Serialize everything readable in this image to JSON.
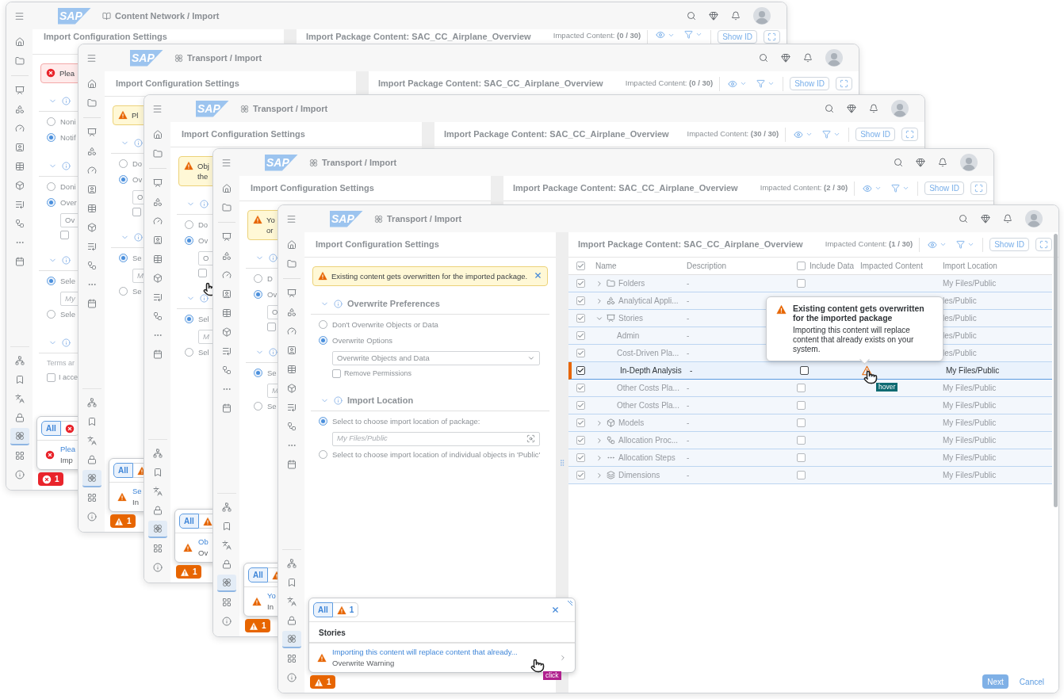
{
  "sidebar": {
    "items": [
      {
        "selected": false
      },
      {
        "selected": false
      },
      {
        "selected": false
      },
      {
        "selected": false
      },
      {
        "selected": false
      },
      {
        "selected": false
      },
      {
        "selected": false
      },
      {
        "selected": false
      },
      {
        "selected": false
      },
      {
        "selected": false
      },
      {
        "selected": false
      },
      {
        "selected": false
      },
      {
        "selected": false
      },
      {
        "selected": false
      },
      {
        "selected": false
      },
      {
        "selected": false
      },
      {
        "selected": true
      },
      {
        "selected": false
      },
      {
        "selected": false
      }
    ]
  },
  "windows": [
    {
      "logo": "SAP",
      "breadcrumb": {
        "kind": "book",
        "text": "Content Network / Import"
      },
      "config": {
        "title": "Import Configuration Settings",
        "strip": {
          "kind": "error",
          "lines": [
            "Plea"
          ]
        },
        "sections": [
          {
            "items": [
              {
                "kind": "radio",
                "label": "Noni",
                "selected": false
              },
              {
                "kind": "radio",
                "label": "Notif",
                "selected": true
              }
            ]
          },
          {
            "items": [
              {
                "kind": "radio",
                "label": "Doni",
                "selected": false
              },
              {
                "kind": "radio",
                "label": "Over",
                "selected": true
              },
              {
                "kind": "select",
                "value": "Ov"
              },
              {
                "kind": "checkbox",
                "checked": false
              }
            ]
          },
          {
            "items": [
              {
                "kind": "radio",
                "label": "Sele",
                "selected": true
              },
              {
                "kind": "input",
                "placeholder": "My"
              },
              {
                "kind": "radio",
                "label": "Sele",
                "selected": false
              }
            ]
          },
          {
            "items": [
              {
                "kind": "text",
                "label": "Terms ar"
              },
              {
                "kind": "consent",
                "label": "I acce",
                "checked": false
              }
            ]
          }
        ]
      },
      "package": {
        "title": "Import Package Content: SAC_CC_Airplane_Overview",
        "impacted": "Impacted Content: **(0 / 30)**",
        "show_id": "Show ID"
      },
      "popover": {
        "filters": [
          {
            "label": "All",
            "selected": true
          },
          {
            "kind": "error",
            "selected": false
          }
        ],
        "items": [
          {
            "kind": "error",
            "title": "Plea",
            "subtitle": "Imp"
          }
        ]
      },
      "badge": {
        "kind": "error",
        "count": "1"
      }
    },
    {
      "logo": "SAP",
      "breadcrumb": {
        "kind": "transport",
        "text": "Transport / Import"
      },
      "config": {
        "title": "Import Configuration Settings",
        "strip": {
          "kind": "warning",
          "lines": [
            "Pl"
          ]
        },
        "sections": [
          {
            "items": [
              {
                "kind": "radio",
                "label": "Do",
                "selected": false
              },
              {
                "kind": "radio",
                "label": "Ov",
                "selected": true
              },
              {
                "kind": "select",
                "value": "O"
              },
              {
                "kind": "checkbox",
                "checked": false
              }
            ]
          },
          {
            "items": [
              {
                "kind": "radio",
                "label": "Se",
                "selected": true
              },
              {
                "kind": "input",
                "placeholder": "M"
              },
              {
                "kind": "radio",
                "label": "Se",
                "selected": false
              }
            ]
          }
        ]
      },
      "package": {
        "title": "Import Package Content: SAC_CC_Airplane_Overview",
        "impacted": "Impacted Content: **(0 / 30)**",
        "show_id": "Show ID"
      },
      "popover": {
        "filters": [
          {
            "label": "All",
            "selected": true
          },
          {
            "kind": "warning",
            "selected": false
          }
        ],
        "items": [
          {
            "kind": "warning",
            "title": "Se",
            "subtitle": "In"
          }
        ]
      },
      "badge": {
        "kind": "warning",
        "count": "1"
      }
    },
    {
      "logo": "SAP",
      "breadcrumb": {
        "kind": "transport",
        "text": "Transport / Import"
      },
      "cursors": [
        {
          "kind": "hand"
        }
      ],
      "config": {
        "title": "Import Configuration Settings",
        "strip": {
          "kind": "warning",
          "lines": [
            "Obj",
            "the"
          ]
        },
        "sections": [
          {
            "items": [
              {
                "kind": "radio",
                "label": "Do",
                "selected": false
              },
              {
                "kind": "radio",
                "label": "Ov",
                "selected": true
              },
              {
                "kind": "select",
                "value": "O"
              },
              {
                "kind": "checkbox",
                "checked": false
              }
            ]
          },
          {
            "items": [
              {
                "kind": "radio",
                "label": "Sel",
                "selected": true
              },
              {
                "kind": "input",
                "placeholder": "M"
              },
              {
                "kind": "radio",
                "label": "Sel",
                "selected": false
              }
            ]
          }
        ]
      },
      "package": {
        "title": "Import Package Content: SAC_CC_Airplane_Overview",
        "impacted": "Impacted Content: **(30 / 30)**",
        "show_id": "Show ID"
      },
      "popover": {
        "filters": [
          {
            "label": "All",
            "selected": true
          },
          {
            "kind": "warning",
            "selected": false
          }
        ],
        "items": [
          {
            "kind": "warning",
            "title": "Ob",
            "subtitle": "Ov"
          }
        ]
      },
      "badge": {
        "kind": "warning",
        "count": "1"
      }
    },
    {
      "logo": "SAP",
      "breadcrumb": {
        "kind": "transport",
        "text": "Transport / Import"
      },
      "config": {
        "title": "Import Configuration Settings",
        "strip": {
          "kind": "warning",
          "lines": [
            "Yo",
            "or"
          ]
        },
        "sections": [
          {
            "items": [
              {
                "kind": "radio",
                "label": "D",
                "selected": false
              },
              {
                "kind": "radio",
                "label": "Ov",
                "selected": true
              },
              {
                "kind": "select",
                "value": "O"
              },
              {
                "kind": "checkbox",
                "checked": false
              }
            ]
          },
          {
            "items": [
              {
                "kind": "radio",
                "label": "Se",
                "selected": true
              },
              {
                "kind": "input",
                "placeholder": "M"
              },
              {
                "kind": "radio",
                "label": "Se",
                "selected": false
              }
            ]
          }
        ]
      },
      "package": {
        "title": "Import Package Content: SAC_CC_Airplane_Overview",
        "impacted": "Impacted Content: **(2 / 30)**",
        "show_id": "Show ID"
      },
      "popover": {
        "filters": [
          {
            "label": "All",
            "selected": true
          },
          {
            "kind": "warning",
            "selected": false
          }
        ],
        "items": [
          {
            "kind": "warning",
            "title": "Yo",
            "subtitle": "In"
          }
        ]
      },
      "badge": {
        "kind": "warning",
        "count": "1"
      }
    },
    {
      "logo": "SAP",
      "breadcrumb": {
        "kind": "transport",
        "text": "Transport / Import"
      },
      "cursors": [
        {
          "kind": "hand",
          "label": "hover"
        },
        {
          "kind": "hand",
          "label": "click"
        }
      ],
      "config": {
        "title": "Import Configuration Settings",
        "strip": {
          "kind": "warning",
          "lines": [
            "Existing content gets overwritten for the imported package."
          ],
          "closable": true
        },
        "sections": [
          {
            "title": "Overwrite Preferences",
            "items": [
              {
                "kind": "radio",
                "label": "Don't Overwrite Objects or Data",
                "selected": false
              },
              {
                "kind": "radio",
                "label": "Overwrite Options",
                "selected": true
              },
              {
                "kind": "select",
                "value": "Overwrite Objects and Data"
              },
              {
                "kind": "checkbox",
                "label": "Remove Permissions",
                "checked": false
              }
            ]
          },
          {
            "title": "Import Location",
            "items": [
              {
                "kind": "radio",
                "label": "Select to choose import location of package:",
                "selected": true
              },
              {
                "kind": "input",
                "placeholder": "My Files/Public"
              },
              {
                "kind": "radio",
                "label": "Select to choose import location of individual objects in 'Public'",
                "selected": false
              }
            ]
          }
        ]
      },
      "package": {
        "title": "Import Package Content: SAC_CC_Airplane_Overview",
        "impacted": "Impacted Content: **(1 / 30)**",
        "show_id": "Show ID",
        "columns": [
          "Name",
          "Description",
          "Include Data",
          "Impacted Content",
          "Import Location"
        ],
        "header_checked": true,
        "include_header_checked": false,
        "rows": [
          {
            "name": "Folders",
            "kind": "folder",
            "expanded": false,
            "selected": false,
            "checked": true,
            "description": "-",
            "include_data": false,
            "location": "My Files/Public"
          },
          {
            "name": "Analytical Appli...",
            "kind": "app",
            "expanded": false,
            "selected": false,
            "checked": true,
            "description": "-",
            "location": "les/Public"
          },
          {
            "name": "Stories",
            "kind": "story",
            "expanded": true,
            "selected": false,
            "checked": true,
            "description": "-",
            "location": "les/Public",
            "children": [
              {
                "name": "Admin",
                "selected": false,
                "checked": true,
                "description": "-",
                "location": "les/Public"
              },
              {
                "name": "Cost-Driven Pla...",
                "selected": false,
                "checked": true,
                "description": "-",
                "location": "les/Public"
              },
              {
                "name": "In-Depth Analysis",
                "selected": true,
                "checked": true,
                "description": "-",
                "include_data": false,
                "impacted": true,
                "location": "My Files/Public"
              },
              {
                "name": "Other Costs Pla...",
                "selected": false,
                "checked": true,
                "description": "-",
                "include_data": false,
                "location": "My Files/Public"
              },
              {
                "name": "Other Costs Pla...",
                "selected": false,
                "checked": true,
                "description": "-",
                "include_data": false,
                "location": "My Files/Public"
              }
            ]
          },
          {
            "name": "Models",
            "kind": "model",
            "expanded": false,
            "selected": false,
            "checked": true,
            "description": "-",
            "include_data": false,
            "location": "My Files/Public"
          },
          {
            "name": "Allocation Proc...",
            "kind": "process",
            "expanded": false,
            "selected": false,
            "checked": true,
            "description": "-",
            "include_data": false,
            "location": "My Files/Public"
          },
          {
            "name": "Allocation Steps",
            "kind": "steps",
            "expanded": false,
            "selected": false,
            "checked": true,
            "description": "-",
            "include_data": false,
            "location": "My Files/Public"
          },
          {
            "name": "Dimensions",
            "kind": "dimension",
            "expanded": false,
            "selected": false,
            "checked": true,
            "description": "-",
            "include_data": false,
            "location": "My Files/Public"
          }
        ],
        "tooltip": {
          "title": "Existing content gets overwritten for the imported package",
          "text": "Importing this content will replace content that already exists on your system."
        },
        "footer": [
          {
            "label": "Next",
            "kind": "primary",
            "disabled": true
          },
          {
            "label": "Cancel",
            "kind": "ghost",
            "disabled": false
          }
        ]
      },
      "popover": {
        "filters": [
          {
            "label": "All",
            "selected": true
          },
          {
            "kind": "warning",
            "count": "1",
            "selected": false
          }
        ],
        "closable": true,
        "group": "Stories",
        "items": [
          {
            "kind": "warning",
            "title": "Importing this content will replace content that already...",
            "subtitle": "Overwrite Warning"
          }
        ]
      },
      "badge": {
        "kind": "warning",
        "count": "1"
      }
    }
  ]
}
